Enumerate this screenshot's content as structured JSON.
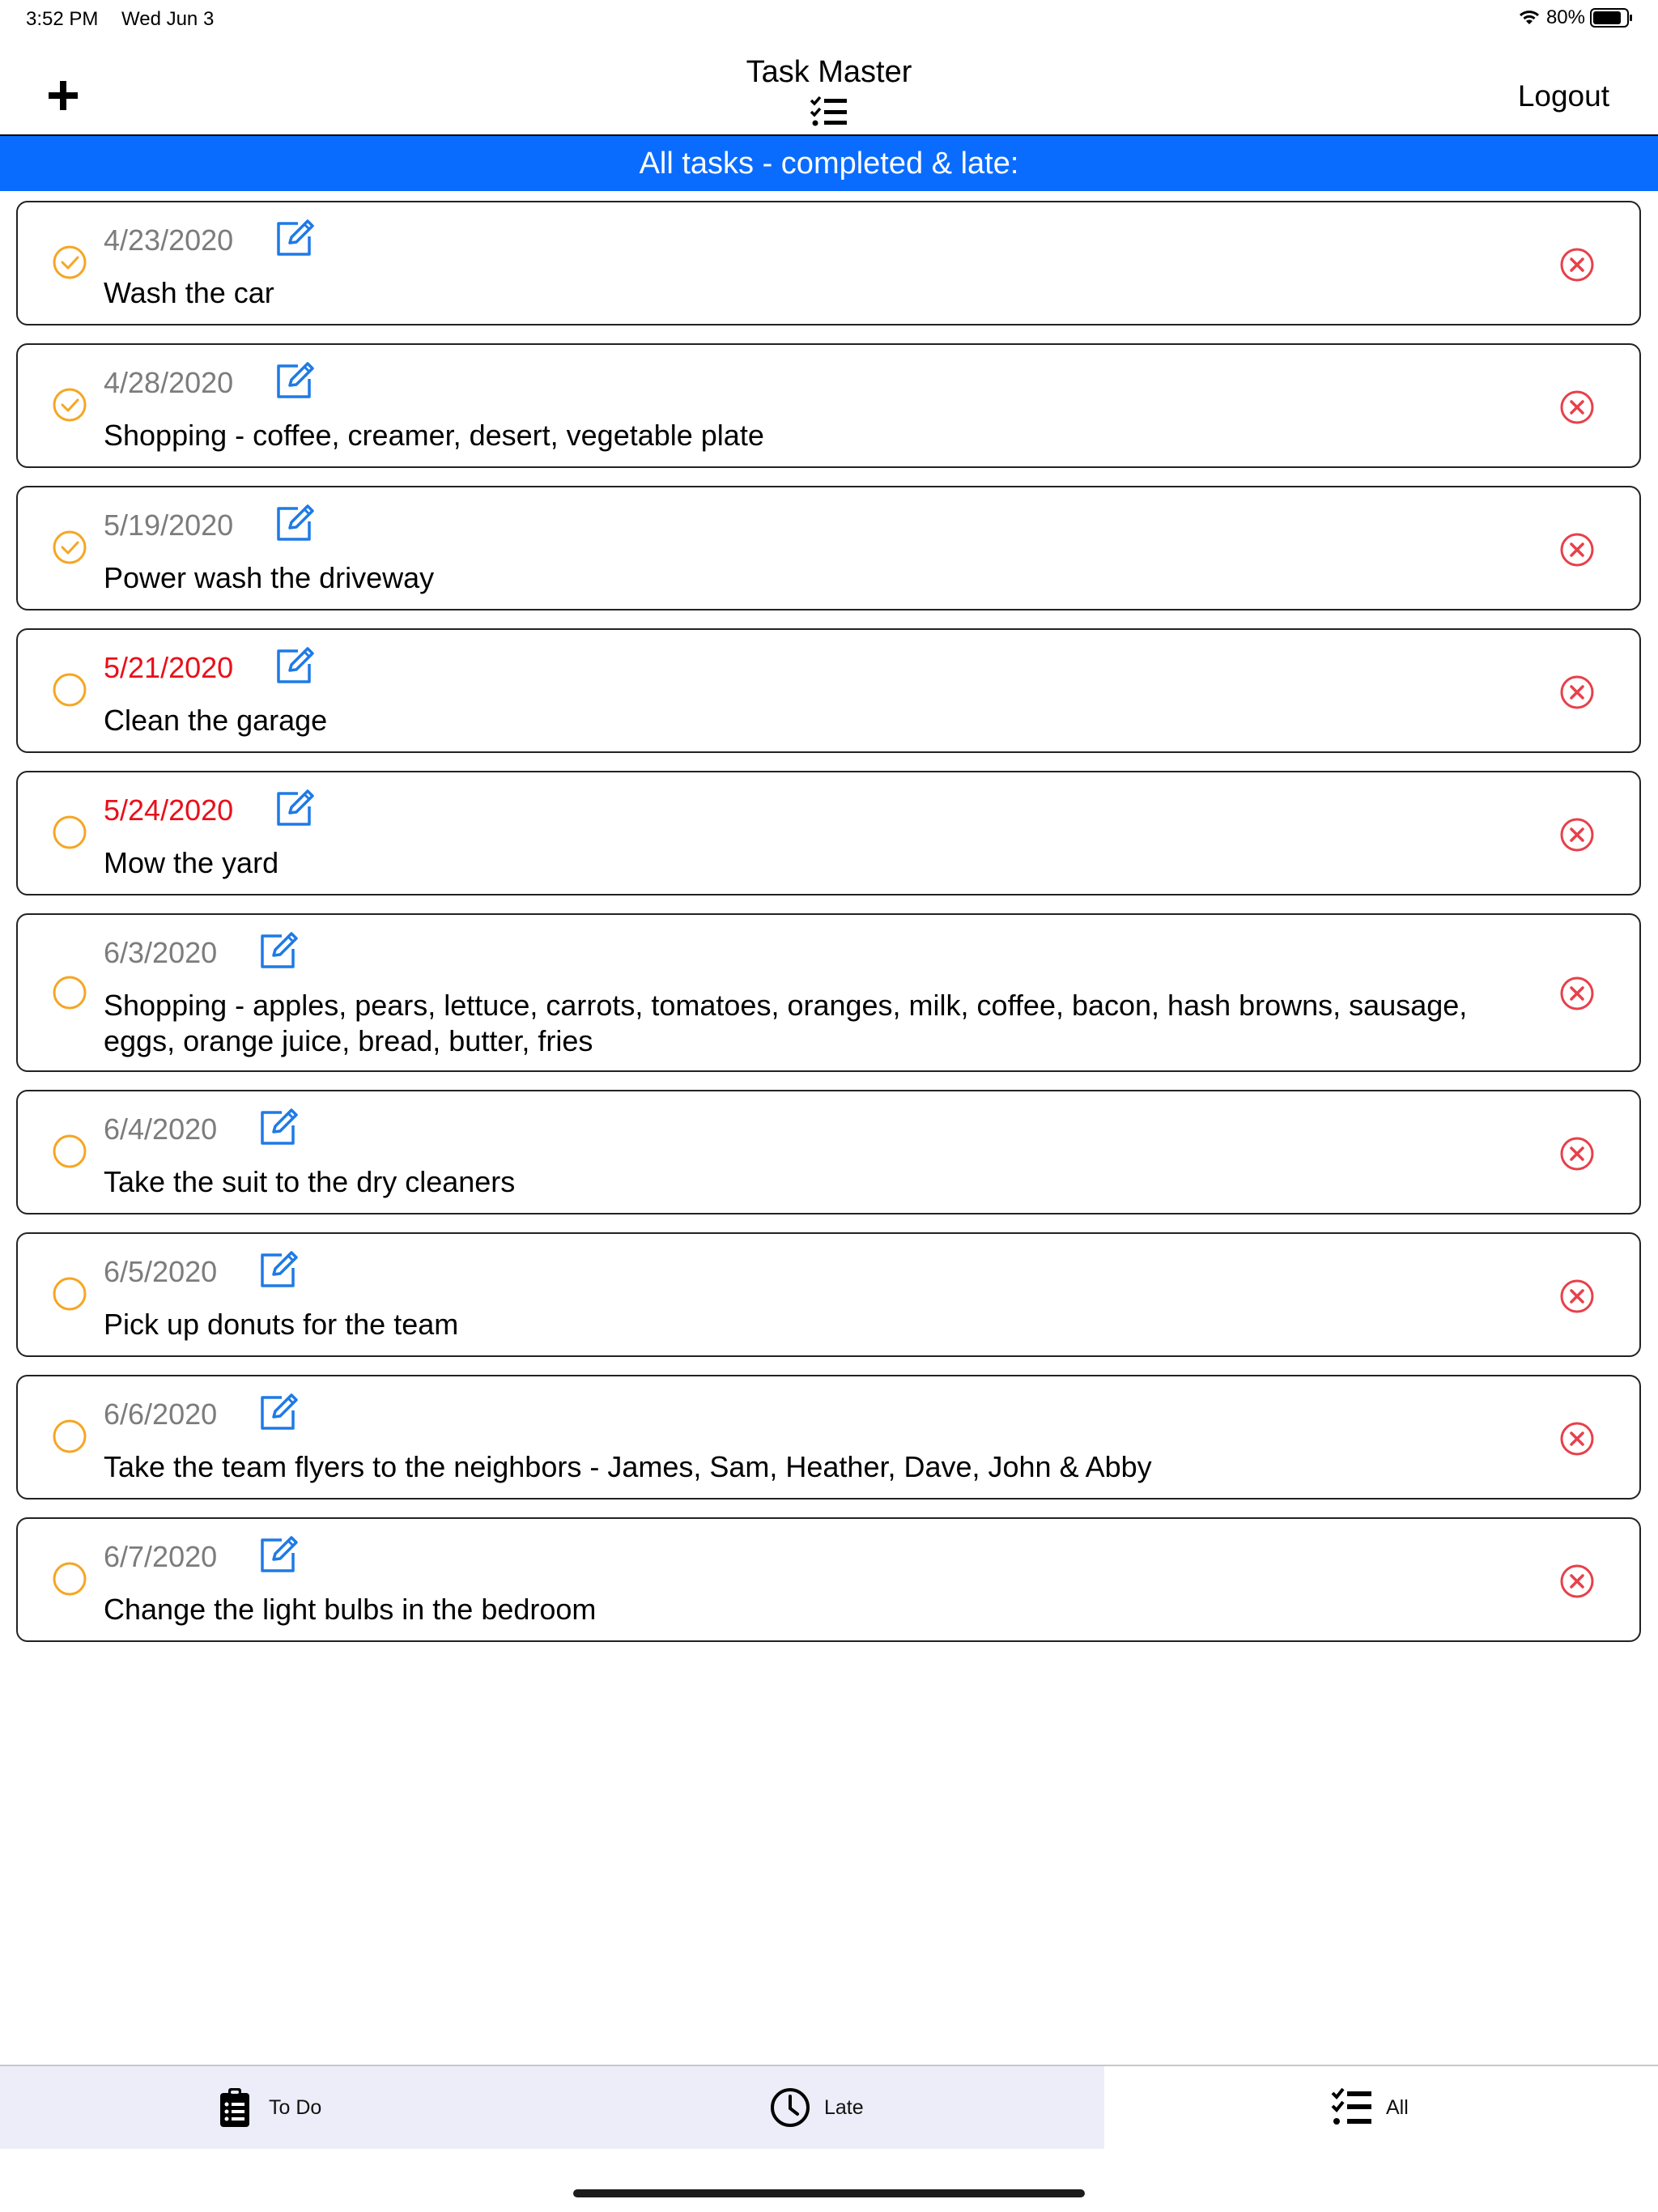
{
  "status_bar": {
    "time": "3:52 PM",
    "date": "Wed Jun 3",
    "battery": "80%"
  },
  "nav": {
    "title": "Task Master",
    "logout": "Logout"
  },
  "banner": {
    "text": "All tasks - completed & late:"
  },
  "colors": {
    "accent": "#0a6cff",
    "complete_orange": "#f5a623",
    "late_red": "#e8101a",
    "delete_red": "#e8404a",
    "edit_blue": "#1e7ae6"
  },
  "tasks": [
    {
      "date": "4/23/2020",
      "text": "Wash the car",
      "completed": true,
      "late": false
    },
    {
      "date": "4/28/2020",
      "text": "Shopping - coffee, creamer, desert, vegetable plate",
      "completed": true,
      "late": false
    },
    {
      "date": "5/19/2020",
      "text": "Power wash the driveway",
      "completed": true,
      "late": false
    },
    {
      "date": "5/21/2020",
      "text": "Clean the garage",
      "completed": false,
      "late": true
    },
    {
      "date": "5/24/2020",
      "text": "Mow the yard",
      "completed": false,
      "late": true
    },
    {
      "date": "6/3/2020",
      "text": "Shopping - apples, pears, lettuce, carrots, tomatoes, oranges, milk, coffee, bacon, hash browns, sausage, eggs, orange juice, bread, butter, fries",
      "completed": false,
      "late": false
    },
    {
      "date": "6/4/2020",
      "text": "Take the suit to the dry cleaners",
      "completed": false,
      "late": false
    },
    {
      "date": "6/5/2020",
      "text": "Pick up donuts for the team",
      "completed": false,
      "late": false
    },
    {
      "date": "6/6/2020",
      "text": "Take the team flyers to the neighbors - James, Sam, Heather, Dave, John & Abby",
      "completed": false,
      "late": false
    },
    {
      "date": "6/7/2020",
      "text": "Change the light bulbs in the bedroom",
      "completed": false,
      "late": false
    }
  ],
  "tabs": [
    {
      "label": "To Do",
      "icon": "clipboard-list-icon",
      "selected": false
    },
    {
      "label": "Late",
      "icon": "clock-icon",
      "selected": false
    },
    {
      "label": "All",
      "icon": "checklist-icon",
      "selected": true
    }
  ]
}
